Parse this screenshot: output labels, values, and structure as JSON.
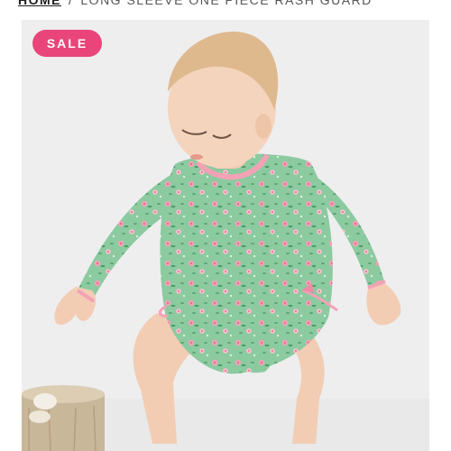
{
  "breadcrumb": {
    "home": "HOME",
    "separator": "/",
    "current": "LONG SLEEVE ONE PIECE RASH GUARD"
  },
  "product": {
    "badge": "SALE",
    "image_alt": "Toddler wearing green floral long sleeve one piece rash guard"
  },
  "colors": {
    "badge": "#e9457a",
    "suit": "#8ccaa0",
    "background": "#eeeeef"
  }
}
